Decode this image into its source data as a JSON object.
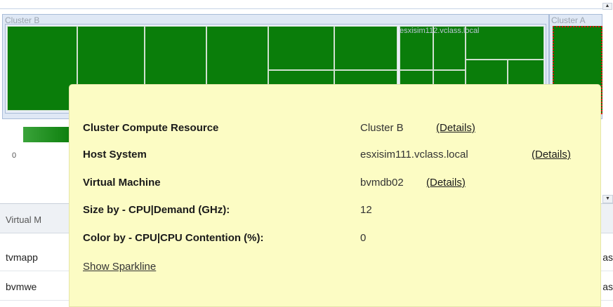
{
  "heatmap": {
    "clusters": [
      {
        "label": "Cluster B"
      },
      {
        "label": "Cluster A"
      }
    ],
    "host_label": "esxisim112.vclass.local",
    "colors": {
      "cell": "#0a7d0a",
      "selected_border": "#e01010"
    }
  },
  "legend": {
    "min_label": "0"
  },
  "table": {
    "column_header": "Virtual M",
    "rows": [
      {
        "name": "tvmapp",
        "right": "as"
      },
      {
        "name": "bvmwe",
        "right": "as"
      }
    ]
  },
  "tooltip": {
    "rows": [
      {
        "key": "Cluster Compute Resource",
        "value": "Cluster B",
        "link": "(Details)"
      },
      {
        "key": "Host System",
        "value": "esxisim111.vclass.local",
        "link": "(Details)"
      },
      {
        "key": "Virtual Machine",
        "value": "bvmdb02",
        "link": "(Details)"
      },
      {
        "key": "Size by - CPU|Demand (GHz):",
        "value": "12",
        "link": ""
      },
      {
        "key": "Color by - CPU|CPU Contention (%):",
        "value": "0",
        "link": ""
      }
    ],
    "sparkline_link": "Show Sparkline"
  }
}
